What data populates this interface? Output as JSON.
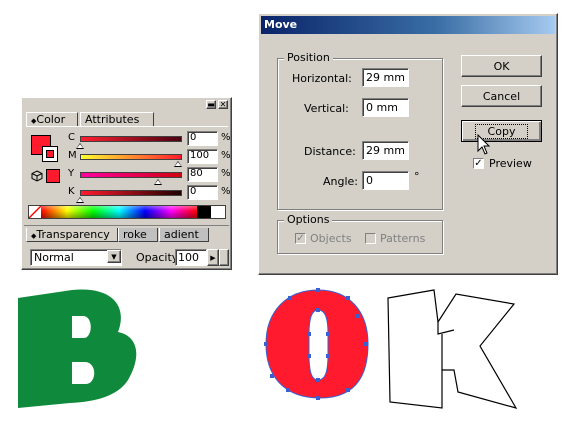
{
  "move_dialog": {
    "title": "Move",
    "position_group": "Position",
    "horizontal_label": "Horizontal:",
    "horizontal_value": "29 mm",
    "vertical_label": "Vertical:",
    "vertical_value": "0 mm",
    "distance_label": "Distance:",
    "distance_value": "29 mm",
    "angle_label": "Angle:",
    "angle_value": "0",
    "angle_unit": "°",
    "options_group": "Options",
    "objects_label": "Objects",
    "patterns_label": "Patterns",
    "ok_label": "OK",
    "cancel_label": "Cancel",
    "copy_label": "Copy",
    "preview_label": "Preview",
    "objects_checked": true,
    "patterns_checked": false,
    "preview_checked": true
  },
  "color_panel": {
    "tab_color": "Color",
    "tab_attributes": "Attributes",
    "channels": [
      {
        "label": "C",
        "value": "0",
        "unit": "%",
        "fraction": 0.0
      },
      {
        "label": "M",
        "value": "100",
        "unit": "%",
        "fraction": 1.0
      },
      {
        "label": "Y",
        "value": "80",
        "unit": "%",
        "fraction": 0.8
      },
      {
        "label": "K",
        "value": "0",
        "unit": "%",
        "fraction": 0.0
      }
    ],
    "fill_color": "#ff1a2e",
    "tab_transparency": "Transparency",
    "tab_stroke": "roke",
    "tab_gradient": "adient",
    "blend_mode": "Normal",
    "opacity_label": "Opacity",
    "opacity_value": "100"
  },
  "canvas": {
    "letter_b": "B",
    "letter_o": "O",
    "letter_k": "K",
    "b_color": "#0f8a3c",
    "o_color": "#ff1a2e",
    "selection_color": "#3a5fd0"
  },
  "icons": [
    "cursor-arrow-icon",
    "close-icon",
    "minimize-icon",
    "dropdown-arrow-icon",
    "color-cube-icon",
    "none-swatch-icon"
  ]
}
